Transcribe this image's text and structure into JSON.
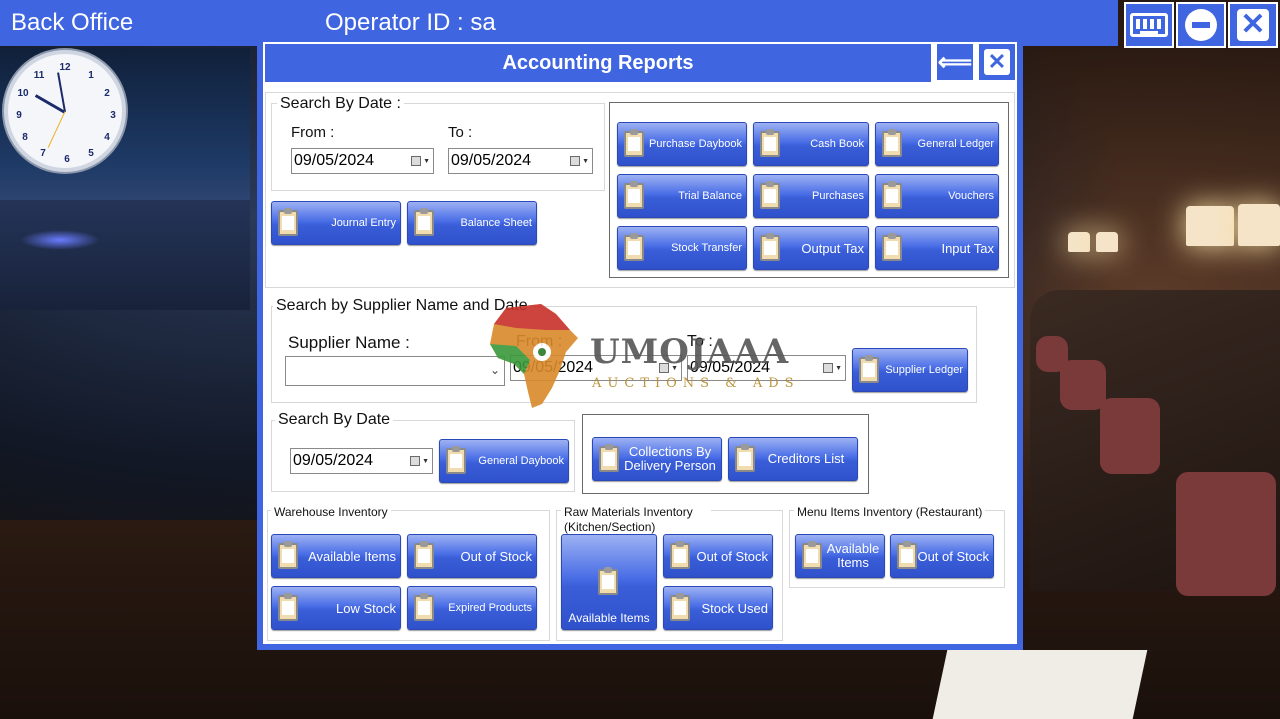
{
  "topbar": {
    "title": "Back Office",
    "operator": "Operator ID :  sa",
    "keyboard_icon": "keyboard-icon",
    "minimize_icon": "minus-circle-icon",
    "close_icon": "close-icon"
  },
  "dialog": {
    "title": "Accounting Reports",
    "back_symbol": "⟸",
    "close_symbol": "✕",
    "search_by_date": {
      "legend": "Search By Date :",
      "from_label": "From :",
      "to_label": "To :",
      "from_value": "09/05/2024",
      "to_value": "09/05/2024"
    },
    "date_buttons": [
      "Journal Entry",
      "Balance Sheet"
    ],
    "report_buttons": [
      "Purchase Daybook",
      "Cash Book",
      "General Ledger",
      "Trial Balance",
      "Purchases",
      "Vouchers",
      "Stock Transfer",
      "Output Tax",
      "Input Tax"
    ],
    "supplier_search": {
      "legend": "Search by Supplier Name and Date",
      "supplier_label": "Supplier Name :",
      "supplier_value": "",
      "from_label": "From :",
      "to_label": "To :",
      "from_value": "09/05/2024",
      "to_value": "09/05/2024",
      "button": "Supplier Ledger"
    },
    "single_date": {
      "legend": "Search By Date",
      "value": "09/05/2024",
      "button": "General Daybook"
    },
    "collections_buttons": [
      "Collections By Delivery Person",
      "Creditors List"
    ],
    "warehouse": {
      "legend": "Warehouse Inventory",
      "buttons": [
        "Available Items",
        "Out of Stock",
        "Low Stock",
        "Expired Products"
      ]
    },
    "raw_materials": {
      "legend": "Raw Materials Inventory (Kitchen/Section)",
      "buttons": [
        "Available Items",
        "Out of Stock",
        "Stock Used"
      ]
    },
    "menu_items": {
      "legend": "Menu Items Inventory (Restaurant)",
      "buttons": [
        "Available Items",
        "Out of Stock"
      ]
    }
  },
  "watermark": {
    "brand": "UMOJAAA",
    "sub": "AUCTIONS & ADS"
  },
  "colors": {
    "accent": "#3f65e0",
    "button_top": "#9db1f3",
    "button_bottom": "#2f52cc"
  }
}
